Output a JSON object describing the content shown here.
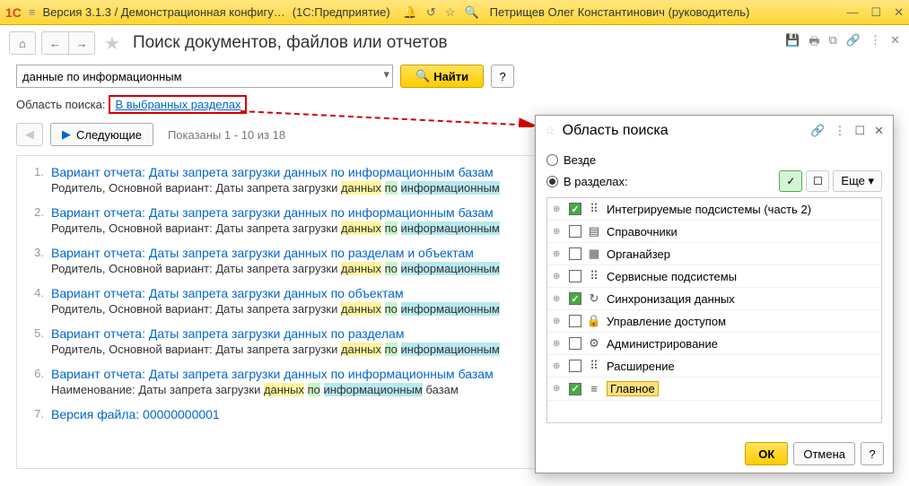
{
  "titlebar": {
    "version": "Версия 3.1.3 / Демонстрационная конфигу…",
    "app": "(1С:Предприятие)",
    "user": "Петрищев Олег Константинович (руководитель)"
  },
  "page": {
    "title": "Поиск документов, файлов или отчетов"
  },
  "search": {
    "value": "данные по информационным",
    "find": "Найти"
  },
  "scope": {
    "label": "Область поиска:",
    "link": "В выбранных разделах"
  },
  "nav": {
    "next": "Следующие",
    "shown": "Показаны 1 - 10 из 18"
  },
  "results": [
    {
      "n": "1.",
      "title": "Вариант отчета: Даты запрета загрузки данных по информационным базам",
      "desc_pre": "Родитель, Основной вариант: Даты запрета загрузки ",
      "h1": "данных",
      "h2": "по",
      "h3": "информационным"
    },
    {
      "n": "2.",
      "title": "Вариант отчета: Даты запрета загрузки данных по информационным базам",
      "desc_pre": "Родитель, Основной вариант: Даты запрета загрузки ",
      "h1": "данных",
      "h2": "по",
      "h3": "информационным"
    },
    {
      "n": "3.",
      "title": "Вариант отчета: Даты запрета загрузки данных по разделам и объектам",
      "desc_pre": "Родитель, Основной вариант: Даты запрета загрузки ",
      "h1": "данных",
      "h2": "по",
      "h3": "информационным"
    },
    {
      "n": "4.",
      "title": "Вариант отчета: Даты запрета загрузки данных по объектам",
      "desc_pre": "Родитель, Основной вариант: Даты запрета загрузки ",
      "h1": "данных",
      "h2": "по",
      "h3": "информационным"
    },
    {
      "n": "5.",
      "title": "Вариант отчета: Даты запрета загрузки данных по разделам",
      "desc_pre": "Родитель, Основной вариант: Даты запрета загрузки ",
      "h1": "данных",
      "h2": "по",
      "h3": "информационным"
    },
    {
      "n": "6.",
      "title": "Вариант отчета: Даты запрета загрузки данных по информационным базам",
      "desc_pre": "Наименование: Даты запрета загрузки ",
      "h1": "данных",
      "h2": "по",
      "h3": "информационным",
      "desc_post": " базам"
    },
    {
      "n": "7.",
      "title": "Версия файла: 00000000001",
      "desc_pre": ""
    }
  ],
  "popup": {
    "title": "Область поиска",
    "everywhere": "Везде",
    "in_sections": "В разделах:",
    "more": "Еще",
    "ok": "ОК",
    "cancel": "Отмена",
    "tree": [
      {
        "chk": true,
        "icon": "⠿",
        "label": "Интегрируемые подсистемы (часть 2)"
      },
      {
        "chk": false,
        "icon": "▤",
        "label": "Справочники"
      },
      {
        "chk": false,
        "icon": "▦",
        "label": "Органайзер"
      },
      {
        "chk": false,
        "icon": "⠿",
        "label": "Сервисные подсистемы"
      },
      {
        "chk": true,
        "icon": "↻",
        "label": "Синхронизация данных"
      },
      {
        "chk": false,
        "icon": "🔒",
        "label": "Управление доступом"
      },
      {
        "chk": false,
        "icon": "⚙",
        "label": "Администрирование"
      },
      {
        "chk": false,
        "icon": "⠿",
        "label": "Расширение"
      },
      {
        "chk": true,
        "icon": "≡",
        "label": "Главное",
        "hl": true
      }
    ]
  }
}
